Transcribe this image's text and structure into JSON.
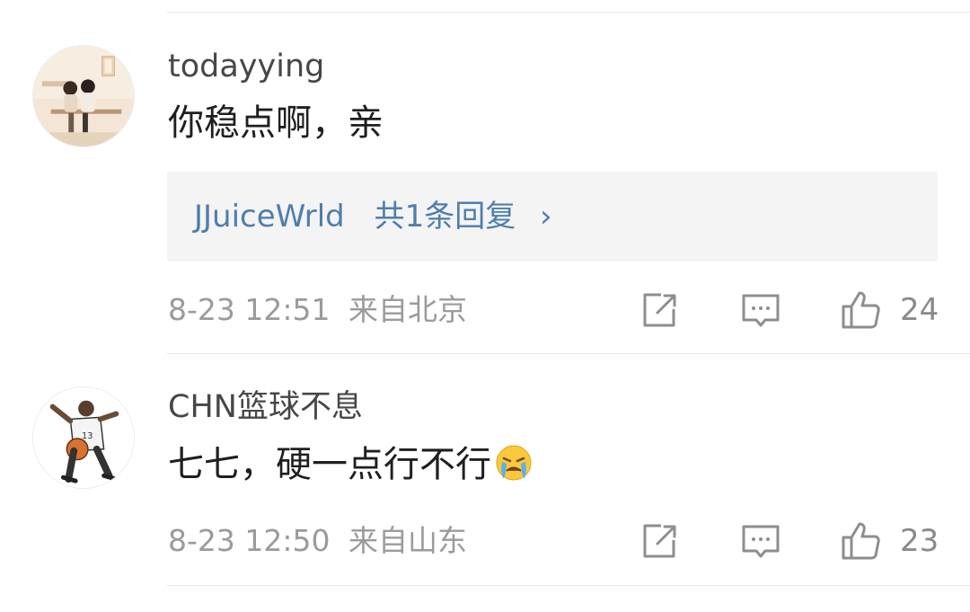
{
  "comments": [
    {
      "username": "todayying",
      "text": "你稳点啊，亲",
      "reply_preview": {
        "name": "JJuiceWrld",
        "summary": "共1条回复",
        "chevron": "›"
      },
      "time": "8-23 12:51",
      "location": "来自北京",
      "like_count": "24",
      "avatar": "couple-illustration-avatar"
    },
    {
      "username": "CHN篮球不息",
      "text": "七七，硬一点行不行",
      "emoji": "crying-face-emoji",
      "time": "8-23 12:50",
      "location": "来自山东",
      "like_count": "23",
      "avatar": "basketball-player-avatar"
    }
  ],
  "icons": {
    "share": "share-icon",
    "comment": "comment-icon",
    "like": "thumbs-up-icon"
  },
  "colors": {
    "link": "#4f7eac",
    "meta": "#9b9b9b",
    "reply_bg": "#f4f4f4"
  }
}
